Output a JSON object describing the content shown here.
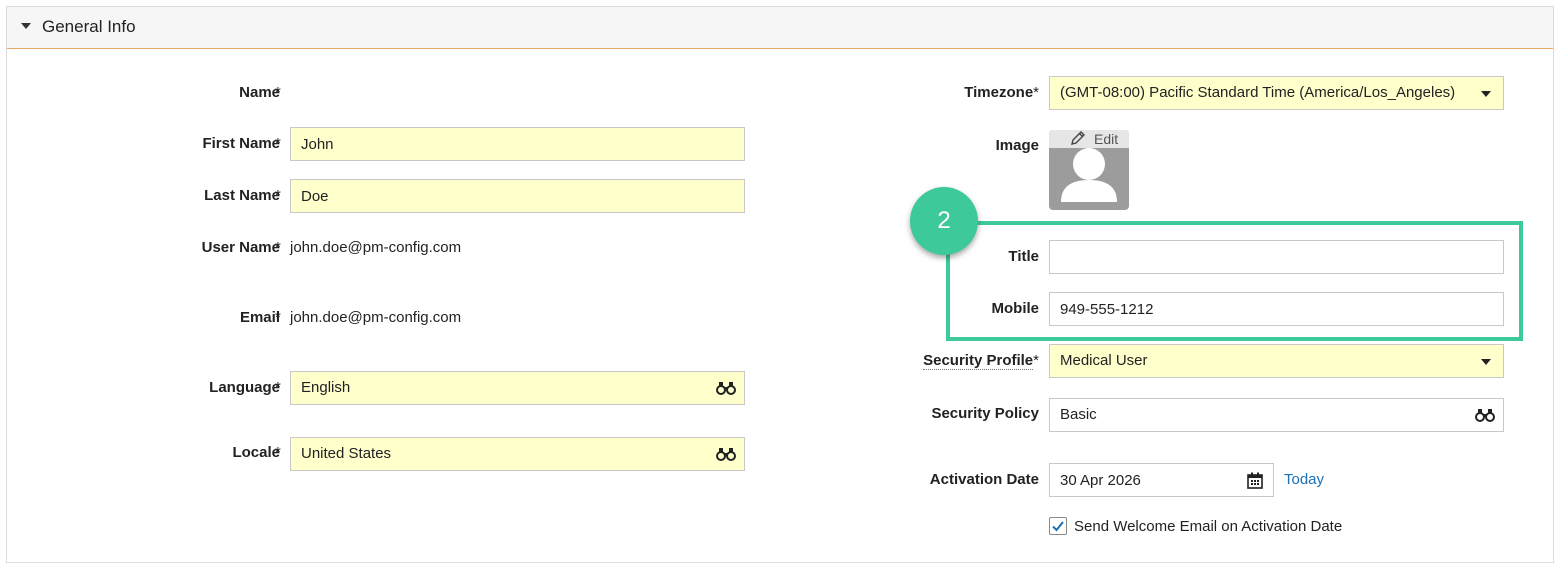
{
  "section": {
    "title": "General Info"
  },
  "left": {
    "name_label": "Name",
    "first_name_label": "First Name",
    "first_name_value": "John",
    "last_name_label": "Last Name",
    "last_name_value": "Doe",
    "user_name_label": "User Name",
    "user_name_value": "john.doe@pm-config.com",
    "email_label": "Email",
    "email_value": "john.doe@pm-config.com",
    "language_label": "Language",
    "language_value": "English",
    "locale_label": "Locale",
    "locale_value": "United States"
  },
  "right": {
    "timezone_label": "Timezone",
    "timezone_value": "(GMT-08:00) Pacific Standard Time (America/Los_Angeles)",
    "image_label": "Image",
    "image_edit_label": "Edit",
    "title_label": "Title",
    "title_value": "",
    "mobile_label": "Mobile",
    "mobile_value": "949-555-1212",
    "security_profile_label": "Security Profile",
    "security_profile_value": "Medical User",
    "security_policy_label": "Security Policy",
    "security_policy_value": "Basic",
    "activation_date_label": "Activation Date",
    "activation_date_value": "30 Apr 2026",
    "today_link": "Today",
    "welcome_email_label": "Send Welcome Email on Activation Date",
    "welcome_email_checked": true
  },
  "required_marker": "*",
  "callout": {
    "step_number": "2"
  },
  "icons": {
    "section_toggle": "caret-down-icon",
    "lookup": "binoculars-icon",
    "dropdown": "chevron-down-icon",
    "calendar": "calendar-icon",
    "edit": "pencil-icon",
    "avatar": "user-silhouette-icon",
    "check": "checkmark-icon"
  },
  "colors": {
    "required_field_bg": "#ffffcc",
    "highlight": "#3ec99b",
    "link": "#1a6fb5",
    "header_divider": "#e9a86a"
  }
}
